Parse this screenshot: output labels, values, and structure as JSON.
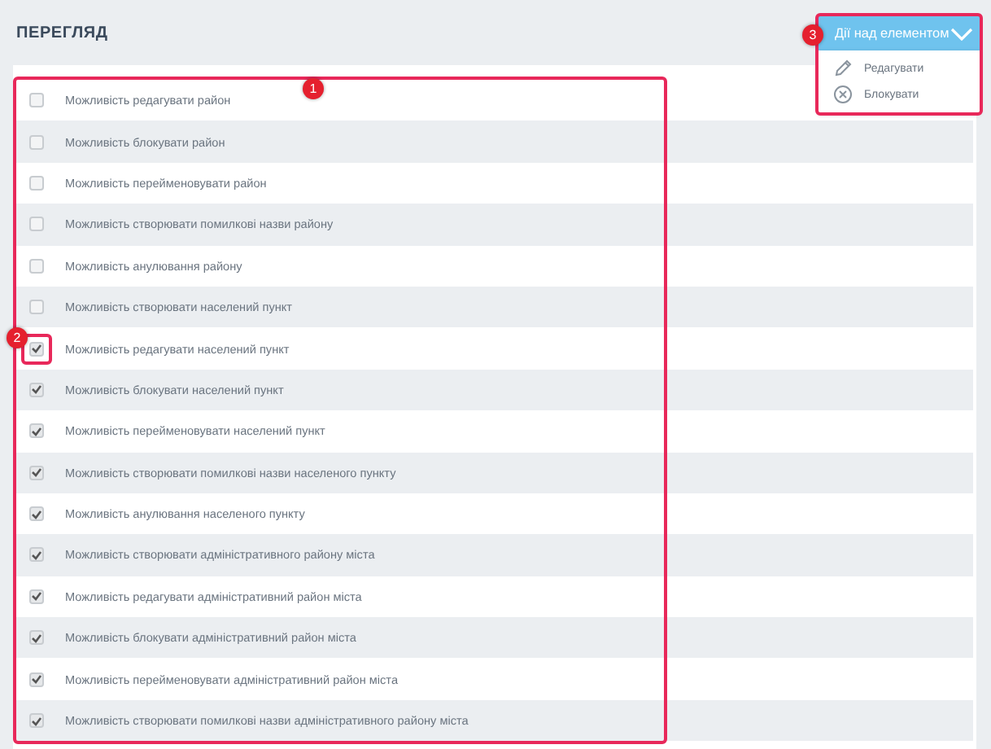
{
  "page": {
    "title": "ПЕРЕГЛЯД"
  },
  "actions": {
    "label": "Дії над елементом",
    "expanded": true,
    "items": [
      {
        "kind": "edit",
        "label": "Редагувати"
      },
      {
        "kind": "block",
        "label": "Блокувати"
      }
    ]
  },
  "permissions": [
    {
      "label": "Можливість редагувати район",
      "checked": false
    },
    {
      "label": "Можливість блокувати район",
      "checked": false
    },
    {
      "label": "Можливість перейменовувати район",
      "checked": false
    },
    {
      "label": "Можливість створювати помилкові назви району",
      "checked": false
    },
    {
      "label": "Можливість анулювання району",
      "checked": false
    },
    {
      "label": "Можливість створювати населений пункт",
      "checked": false
    },
    {
      "label": "Можливість редагувати населений пункт",
      "checked": true
    },
    {
      "label": "Можливість блокувати населений пункт",
      "checked": true
    },
    {
      "label": "Можливість перейменовувати населений пункт",
      "checked": true
    },
    {
      "label": "Можливість створювати помилкові назви населеного пункту",
      "checked": true
    },
    {
      "label": "Можливість анулювання населеного пункту",
      "checked": true
    },
    {
      "label": "Можливість створювати адміністративного району міста",
      "checked": true
    },
    {
      "label": "Можливість редагувати адміністративний район міста",
      "checked": true
    },
    {
      "label": "Можливість блокувати адміністративний район міста",
      "checked": true
    },
    {
      "label": "Можливість перейменовувати адміністративний район міста",
      "checked": true
    },
    {
      "label": "Можливість створювати помилкові назви адміністративного району міста",
      "checked": true
    }
  ],
  "callouts": [
    {
      "kind": "list",
      "number": "1"
    },
    {
      "kind": "checkbox",
      "number": "2"
    },
    {
      "kind": "actions",
      "number": "3"
    }
  ]
}
